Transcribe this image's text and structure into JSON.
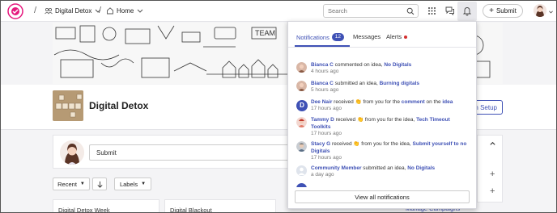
{
  "breadcrumb": {
    "separator": "/",
    "community": "Digital Detox",
    "home": "Home"
  },
  "search": {
    "placeholder": "Search"
  },
  "toolbar": {
    "submit_label": "Submit"
  },
  "community": {
    "title": "Digital Detox",
    "setup_label": "n Setup"
  },
  "composer": {
    "placeholder": "Submit"
  },
  "filters": {
    "recent": "Recent",
    "labels": "Labels"
  },
  "cards": [
    "Digital Detox Week",
    "Digital Blackout"
  ],
  "manage_link": "Manage Campaigns",
  "notifications": {
    "tabs": [
      {
        "label": "Notifications",
        "count": "12"
      },
      {
        "label": "Messages"
      },
      {
        "label": "Alerts"
      }
    ],
    "items": [
      {
        "actor": "Bianca C",
        "text": " commented on idea, ",
        "target": "No Digitals",
        "time": "4 hours ago",
        "avatar": "photo-woman"
      },
      {
        "actor": "Bianca C",
        "text": " submitted an idea, ",
        "target": "Burning digitals",
        "time": "5 hours ago",
        "avatar": "photo-woman"
      },
      {
        "actor": "Dee Nair",
        "text": " received 👏 from you for the ",
        "target": "comment",
        "text2": " on the ",
        "target2": "idea",
        "time": "17 hours ago",
        "avatar": "initial",
        "initial": "D"
      },
      {
        "actor": "Tammy D",
        "text": " received 👏 from you for the idea, ",
        "target": "Tech Timeout Toolkits",
        "time": "17 hours ago",
        "avatar": "photo-red"
      },
      {
        "actor": "Stacy G",
        "text": " received 👏 from you for the idea, ",
        "target": "Submit yourself to no Digitals",
        "time": "17 hours ago",
        "avatar": "photo-gray"
      },
      {
        "actor": "Community Member",
        "text": " submitted an idea, ",
        "target": "No Digitals",
        "time": "a day ago",
        "avatar": "placeholder"
      }
    ],
    "view_all": "View all notifications"
  },
  "colors": {
    "accent": "#3f51b5",
    "alert": "#d32f2f"
  }
}
